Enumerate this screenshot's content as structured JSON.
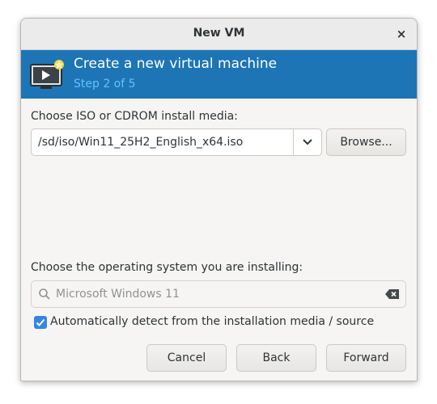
{
  "window": {
    "title": "New VM",
    "close_glyph": "×"
  },
  "banner": {
    "title": "Create a new virtual machine",
    "step": "Step 2 of 5",
    "icon": "vm-monitor-icon",
    "bg_color": "#1d75b5",
    "step_color": "#62c2ff"
  },
  "media": {
    "label": "Choose ISO or CDROM install media:",
    "value": "/sd/iso/Win11_25H2_English_x64.iso",
    "browse_label": "Browse..."
  },
  "os": {
    "label": "Choose the operating system you are installing:",
    "placeholder": "Microsoft Windows 11",
    "auto_detect_label": "Automatically detect from the installation media / source",
    "auto_detect_checked": true
  },
  "buttons": {
    "cancel": "Cancel",
    "back": "Back",
    "forward": "Forward"
  },
  "colors": {
    "accent": "#3584e4"
  }
}
